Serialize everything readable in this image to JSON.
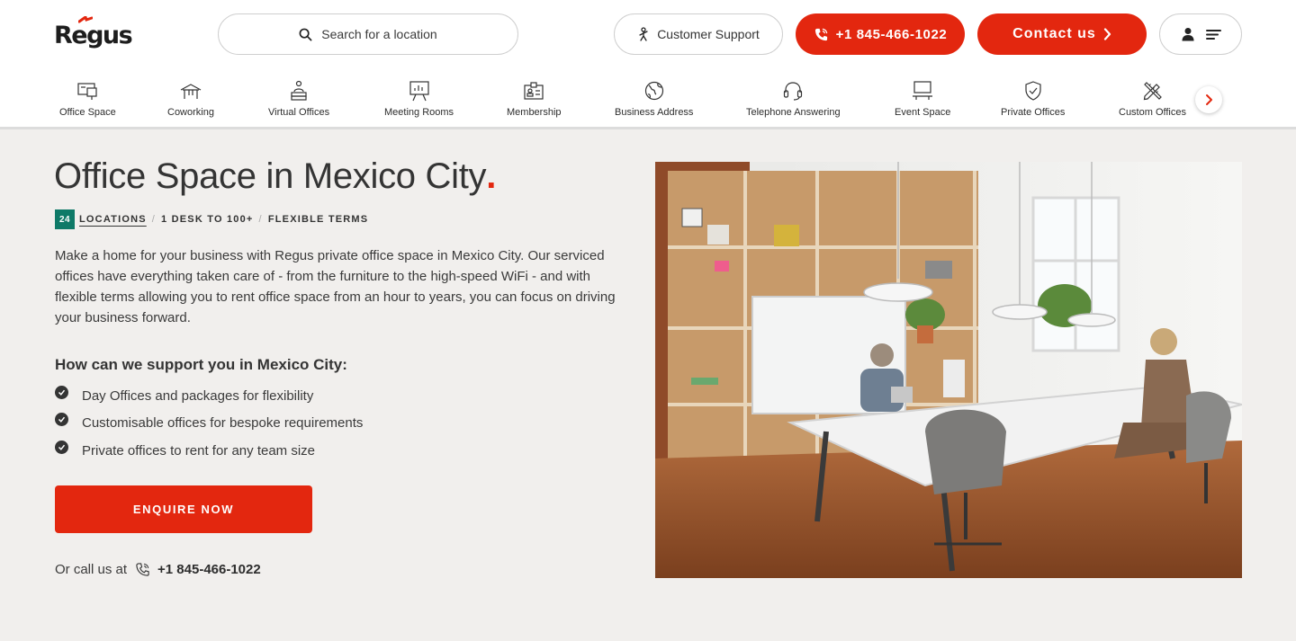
{
  "brand": {
    "logo_text": "Regus",
    "accent": "#e3270f",
    "teal": "#0f7a68"
  },
  "header": {
    "search_placeholder": "Search for a location",
    "support_label": "Customer Support",
    "phone_label": "+1 845-466-1022",
    "contact_label": "Contact us",
    "icons": {
      "search": "search-icon",
      "support": "person-icon",
      "phone": "phone-icon",
      "contact": "chevron-right-icon",
      "account": "user-icon",
      "menu": "hamburger-icon"
    }
  },
  "categories": [
    {
      "label": "Office Space",
      "icon": "office-desk-icon"
    },
    {
      "label": "Coworking",
      "icon": "coworking-icon"
    },
    {
      "label": "Virtual Offices",
      "icon": "virtual-office-icon"
    },
    {
      "label": "Meeting Rooms",
      "icon": "presentation-board-icon"
    },
    {
      "label": "Membership",
      "icon": "membership-card-icon"
    },
    {
      "label": "Business Address",
      "icon": "globe-icon"
    },
    {
      "label": "Telephone Answering",
      "icon": "headset-icon"
    },
    {
      "label": "Event Space",
      "icon": "event-space-icon"
    },
    {
      "label": "Private Offices",
      "icon": "shield-check-icon"
    },
    {
      "label": "Custom Offices",
      "icon": "pencil-ruler-icon"
    }
  ],
  "main": {
    "title": "Office Space in Mexico City",
    "title_dot": ".",
    "meta": {
      "count": "24",
      "locations": "LOCATIONS",
      "desks": "1 DESK TO 100+",
      "terms": "FLEXIBLE TERMS",
      "separator": "/"
    },
    "intro": "Make a home for your business with Regus private office space in Mexico City. Our serviced offices have everything taken care of - from the furniture to the high-speed WiFi - and with flexible terms allowing you to rent office space from an hour to years, you can focus on driving your business forward.",
    "support_heading": "How can we support you in Mexico City:",
    "bullets": [
      "Day Offices and packages for flexibility",
      "Customisable offices for bespoke requirements",
      "Private offices to rent for any team size"
    ],
    "enquire_label": "ENQUIRE NOW",
    "call_prefix": "Or call us at",
    "call_number": "+1 845-466-1022"
  }
}
